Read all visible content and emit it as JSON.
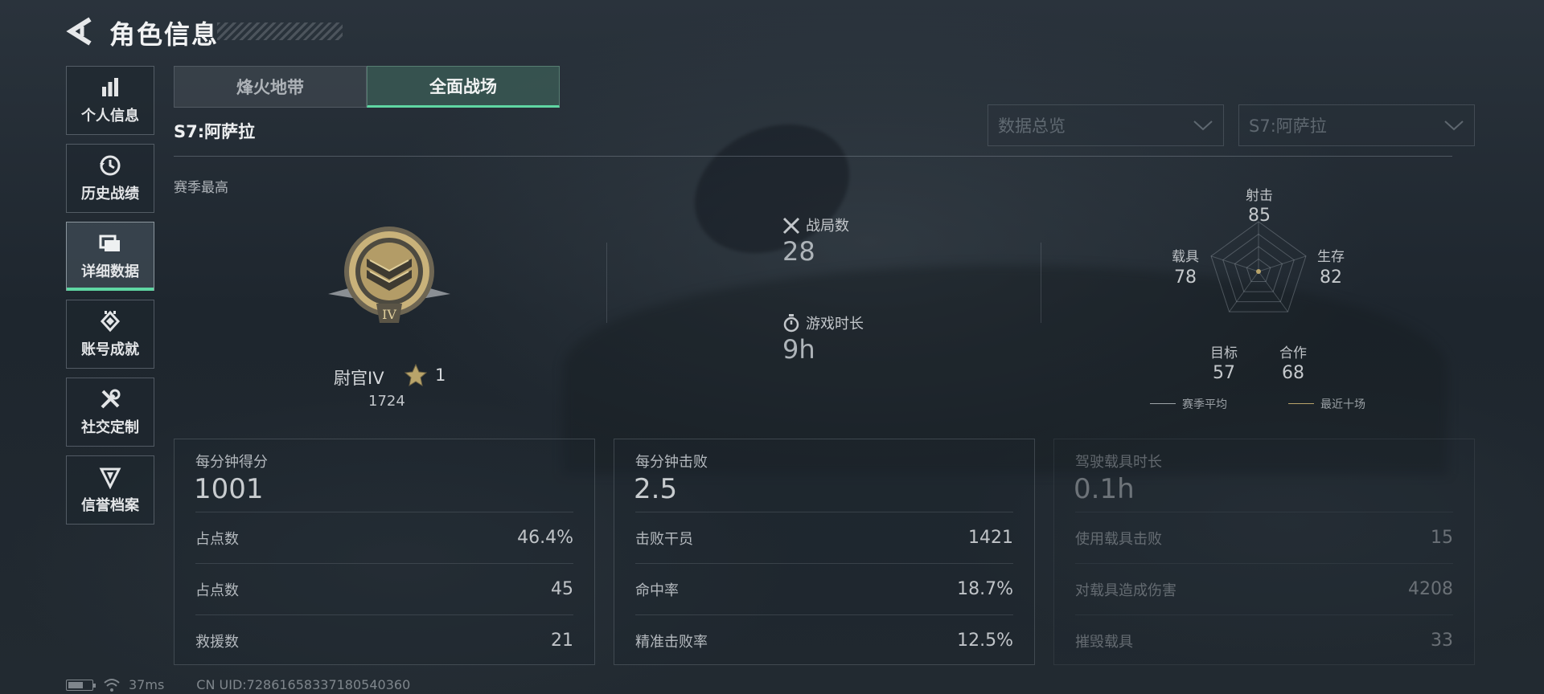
{
  "header": {
    "title": "角色信息"
  },
  "sidebar": {
    "items": [
      {
        "label": "个人信息",
        "icon": "bar-chart-icon"
      },
      {
        "label": "历史战绩",
        "icon": "history-icon"
      },
      {
        "label": "详细数据",
        "icon": "folders-icon",
        "active": true
      },
      {
        "label": "账号成就",
        "icon": "achievement-icon"
      },
      {
        "label": "社交定制",
        "icon": "tools-icon"
      },
      {
        "label": "信誉档案",
        "icon": "shield-icon"
      }
    ]
  },
  "tabs": [
    {
      "label": "烽火地带",
      "active": false
    },
    {
      "label": "全面战场",
      "active": true
    }
  ],
  "season_title": "S7:阿萨拉",
  "filters": {
    "overview": "数据总览",
    "season": "S7:阿萨拉"
  },
  "season_best": {
    "label": "赛季最高",
    "rank_name": "尉官IV",
    "stars": "1",
    "points": "1724"
  },
  "summary": {
    "matches_label": "战局数",
    "matches_value": "28",
    "playtime_label": "游戏时长",
    "playtime_value": "9h"
  },
  "radar": {
    "axes": [
      {
        "label": "射击",
        "value": 85
      },
      {
        "label": "生存",
        "value": 82
      },
      {
        "label": "合作",
        "value": 68
      },
      {
        "label": "目标",
        "value": 57
      },
      {
        "label": "载具",
        "value": 78
      }
    ],
    "legend": [
      {
        "label": "赛季平均",
        "color": "#9ea4a8"
      },
      {
        "label": "最近十场",
        "color": "#b9a46a"
      }
    ]
  },
  "panels": [
    {
      "title": "每分钟得分",
      "value": "1001",
      "rows": [
        {
          "label": "占点数",
          "value": "46.4%"
        },
        {
          "label": "占点数",
          "value": "45"
        },
        {
          "label": "救援数",
          "value": "21"
        }
      ]
    },
    {
      "title": "每分钟击败",
      "value": "2.5",
      "rows": [
        {
          "label": "击败干员",
          "value": "1421"
        },
        {
          "label": "命中率",
          "value": "18.7%"
        },
        {
          "label": "精准击败率",
          "value": "12.5%"
        }
      ]
    },
    {
      "title": "驾驶载具时长",
      "value": "0.1h",
      "rows": [
        {
          "label": "使用载具击败",
          "value": "15"
        },
        {
          "label": "对载具造成伤害",
          "value": "4208"
        },
        {
          "label": "摧毁载具",
          "value": "33"
        }
      ]
    }
  ],
  "status": {
    "ping": "37ms",
    "uid": "CN UID:72861658337180540360"
  },
  "colors": {
    "accent": "#5fd6a3",
    "rank_gold": "#c9b27a"
  }
}
